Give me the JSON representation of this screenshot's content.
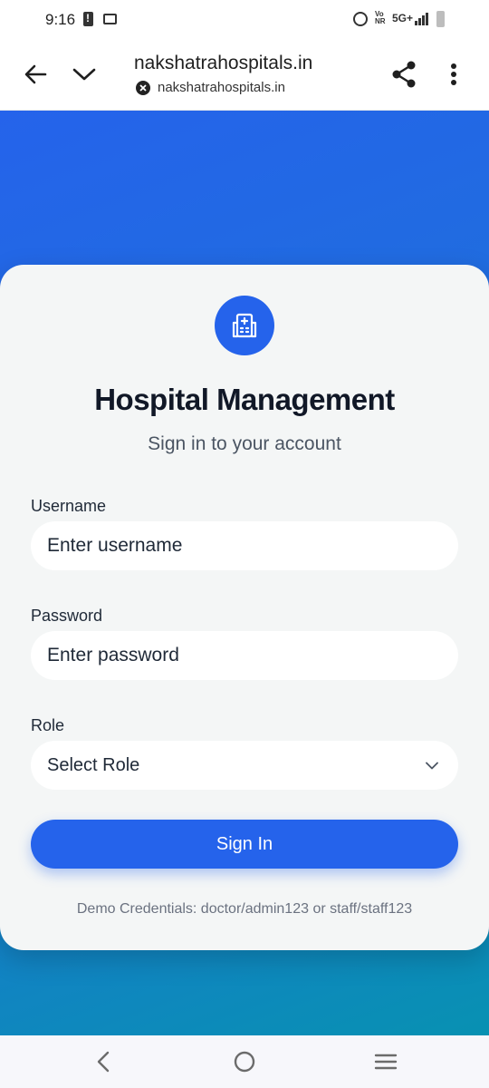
{
  "status_bar": {
    "time": "9:16",
    "network": "5G+",
    "volte_top": "Vo",
    "volte_bottom": "NR"
  },
  "browser": {
    "page_title": "nakshatrahospitals.in",
    "url": "nakshatrahospitals.in"
  },
  "login": {
    "title": "Hospital Management",
    "subtitle": "Sign in to your account",
    "username_label": "Username",
    "username_placeholder": "Enter username",
    "username_value": "",
    "password_label": "Password",
    "password_placeholder": "Enter password",
    "password_value": "",
    "role_label": "Role",
    "role_selected": "Select Role",
    "signin_label": "Sign In",
    "demo_text": "Demo Credentials: doctor/admin123 or staff/staff123"
  },
  "colors": {
    "primary": "#2563eb",
    "gradient_end": "#0891b2",
    "card_bg": "#f4f6f6"
  },
  "icons": {
    "back": "back-arrow-icon",
    "tabs": "chevron-down-icon",
    "share": "share-icon",
    "menu": "more-vert-icon",
    "site_info": "close-circle-icon",
    "logo": "hospital-building-icon"
  }
}
